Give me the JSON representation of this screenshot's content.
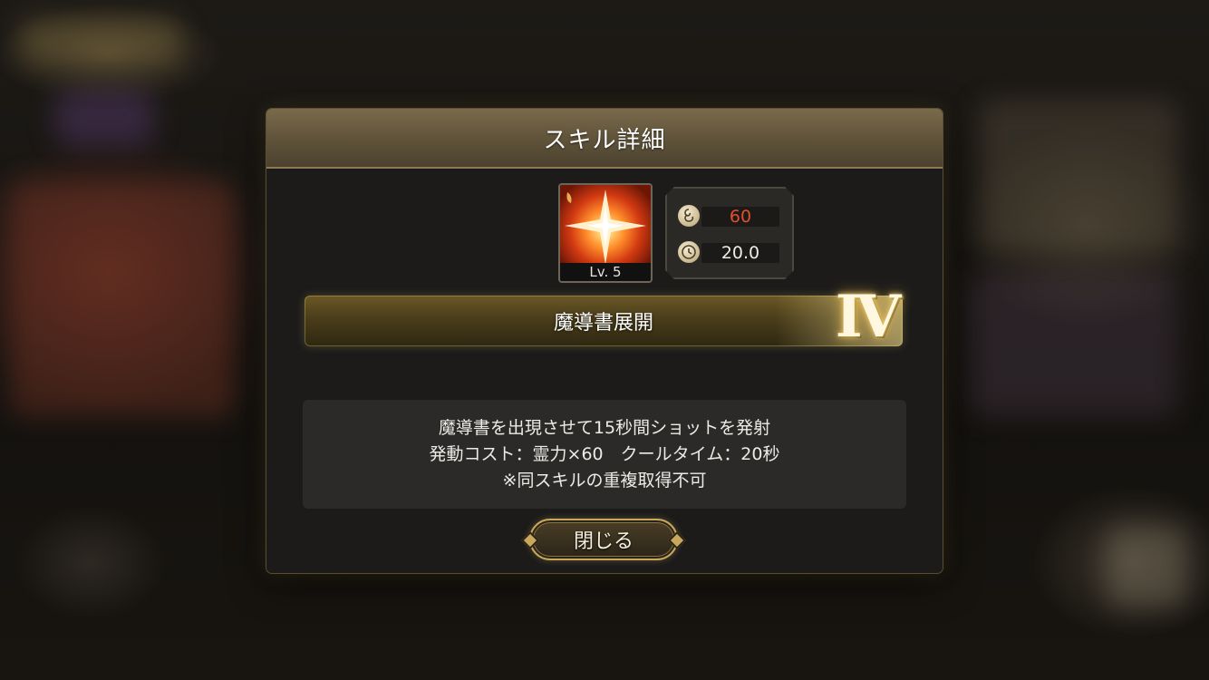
{
  "dialog": {
    "title": "スキル詳細",
    "close_label": "閉じる"
  },
  "skill": {
    "icon": "starburst-icon",
    "level": "Lv. 5",
    "name": "魔導書展開",
    "rank": "Ⅳ",
    "cost": "60",
    "cooldown": "20.0",
    "description": [
      "魔導書を出現させて15秒間ショットを発射",
      "発動コスト：霊力×60　クールタイム：20秒",
      "※同スキルの重複取得不可"
    ]
  },
  "colors": {
    "header": "#6a5d42",
    "cost_text": "#e0502e",
    "accent_gold": "#c9a85e"
  }
}
